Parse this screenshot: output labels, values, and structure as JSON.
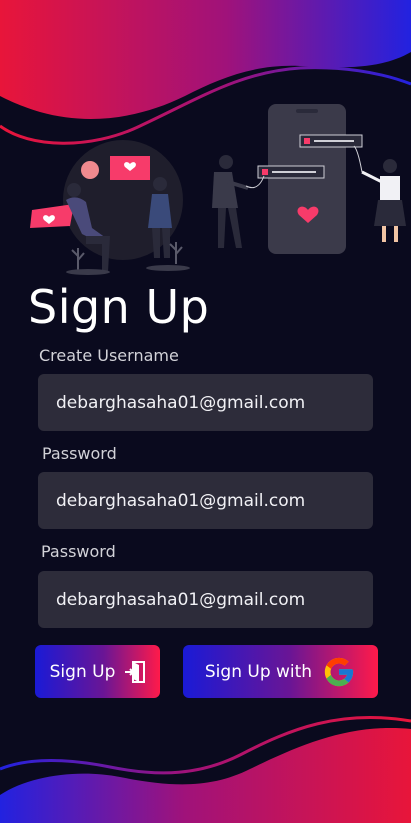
{
  "header": {
    "title": "Sign Up"
  },
  "form": {
    "username": {
      "label": "Create Username",
      "value": "debarghasaha01@gmail.com"
    },
    "password": {
      "label": "Password",
      "value": "debarghasaha01@gmail.com"
    },
    "password_confirm": {
      "label": "Password",
      "value": "debarghasaha01@gmail.com"
    }
  },
  "actions": {
    "signup_label": "Sign Up",
    "google_label": "Sign Up with"
  },
  "icons": {
    "signup": "door-enter-icon",
    "google": "google-logo-icon"
  },
  "colors": {
    "background": "#0a0a1e",
    "accent_pink": "#ff1a4a",
    "accent_blue": "#1a1ad6",
    "field": "#2d2c3a",
    "heart": "#f73b6a"
  }
}
